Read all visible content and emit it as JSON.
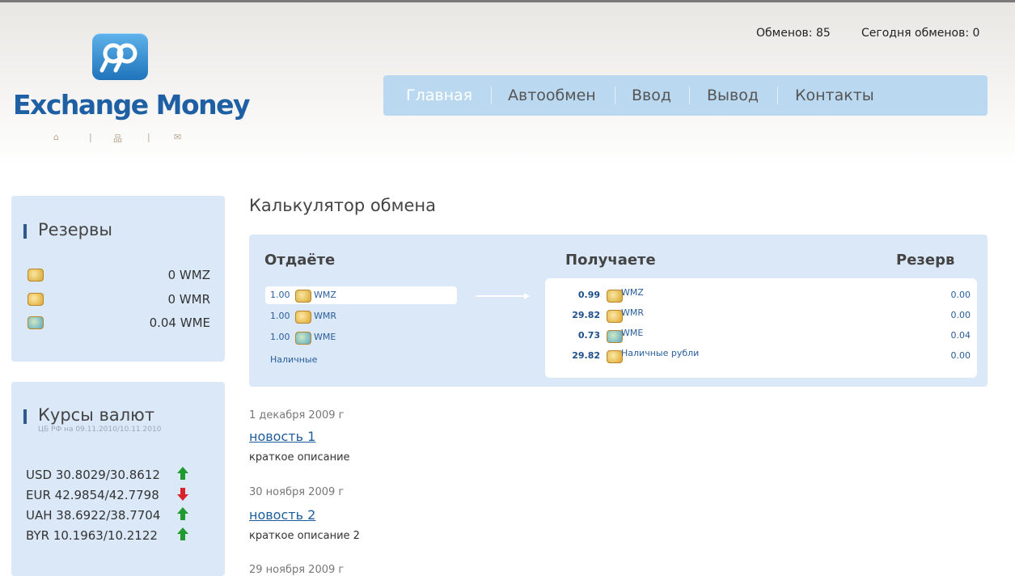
{
  "header": {
    "logo_text": "Exchange Money",
    "logo_links": [
      "⌂",
      "|",
      "品",
      "|",
      "✉"
    ],
    "stats": {
      "exchanges": "Обменов: 85",
      "today": "Сегодня обменов: 0"
    },
    "nav": [
      "Главная",
      "Автообмен",
      "Ввод",
      "Вывод",
      "Контакты"
    ],
    "nav_active": 0
  },
  "sidebar": {
    "reserves": {
      "title": "Резервы",
      "items": [
        {
          "currency": "WMZ",
          "amount": "0 WMZ"
        },
        {
          "currency": "WMR",
          "amount": "0 WMR"
        },
        {
          "currency": "WME",
          "amount": "0.04 WME"
        }
      ]
    },
    "rates": {
      "title": "Курсы валют",
      "subtitle": "ЦБ РФ на 09.11.2010/10.11.2010",
      "items": [
        {
          "text": "USD 30.8029/30.8612",
          "trend": "up"
        },
        {
          "text": "EUR 42.9854/42.7798",
          "trend": "down"
        },
        {
          "text": "UAH 38.6922/38.7704",
          "trend": "up"
        },
        {
          "text": "BYR 10.1963/10.2122",
          "trend": "up"
        }
      ],
      "colors": {
        "up": "#1f9a2e",
        "down": "#d8232a"
      }
    }
  },
  "calculator": {
    "title": "Калькулятор обмена",
    "headers": {
      "give": "Отдаёте",
      "get": "Получаете",
      "reserve": "Резерв"
    },
    "give": [
      {
        "amount": "1.00",
        "code": "WMZ",
        "icon": "wmz-coin-icon"
      },
      {
        "amount": "1.00",
        "code": "WMR",
        "icon": "wmr-coin-icon"
      },
      {
        "amount": "1.00",
        "code": "WME",
        "icon": "wme-coin-icon"
      },
      {
        "amount": "",
        "code": "Наличные",
        "icon": ""
      }
    ],
    "give_selected": 0,
    "get": [
      {
        "amount": "0.99",
        "code": "WMZ",
        "reserve": "0.00"
      },
      {
        "amount": "29.82",
        "code": "WMR",
        "reserve": "0.00"
      },
      {
        "amount": "0.73",
        "code": "WME",
        "reserve": "0.04"
      },
      {
        "amount": "29.82",
        "code": "Наличные рубли",
        "reserve": "0.00"
      }
    ]
  },
  "news": [
    {
      "date": "1 декабря 2009 г",
      "title": "новость 1",
      "desc": "краткое описание"
    },
    {
      "date": "30 ноября 2009 г",
      "title": "новость 2",
      "desc": "краткое описание 2"
    },
    {
      "date": "29 ноября 2009 г",
      "title": "",
      "desc": ""
    }
  ]
}
